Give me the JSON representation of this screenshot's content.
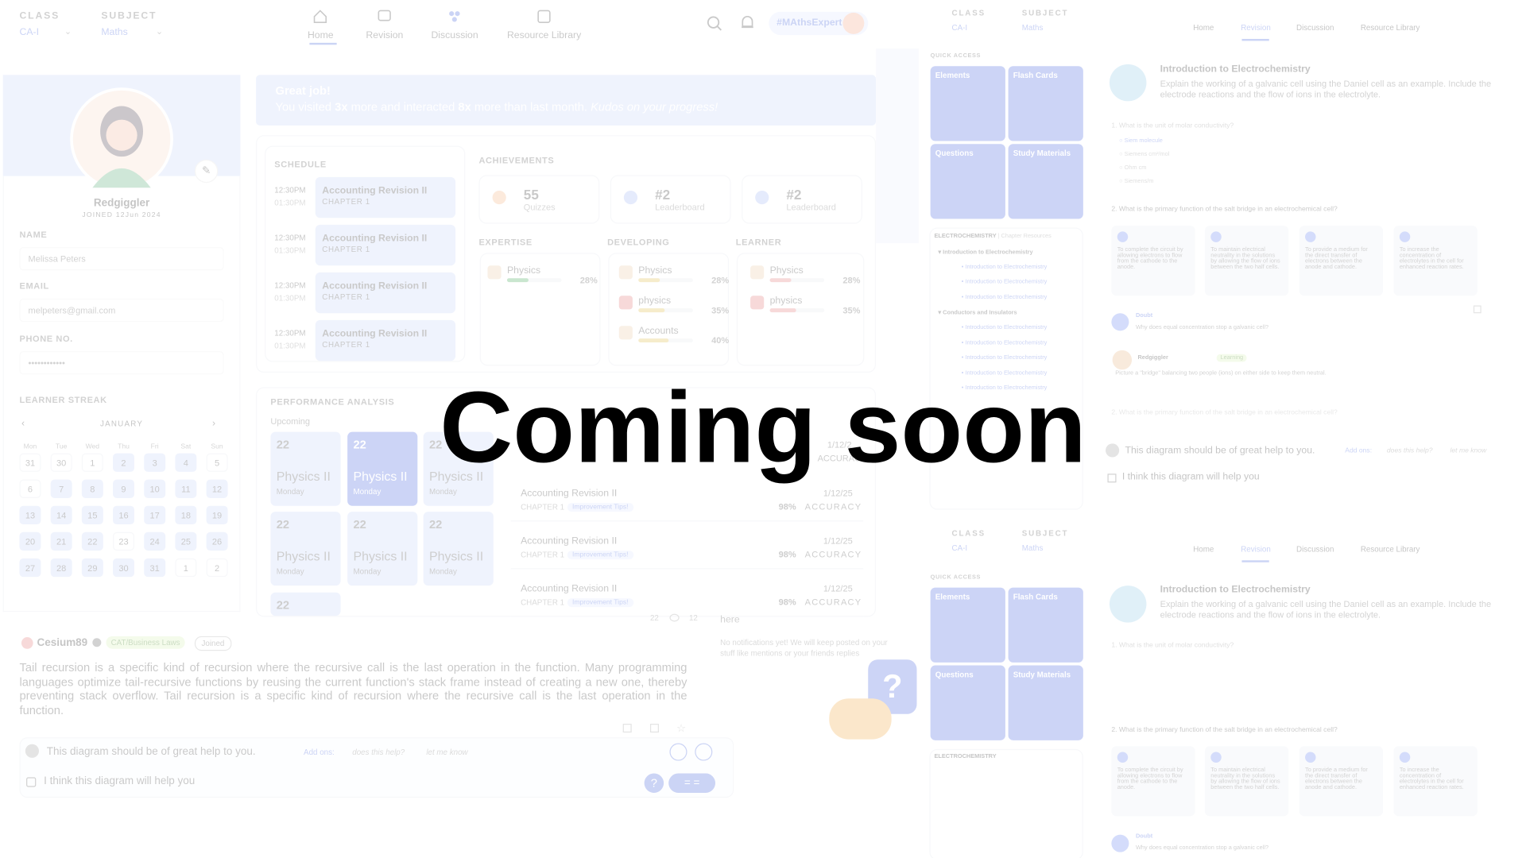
{
  "header": {
    "class_label": "CLASS",
    "class_value": "CA-I",
    "subject_label": "SUBJECT",
    "subject_value": "Maths",
    "tabs": [
      "Home",
      "Revision",
      "Discussion",
      "Resource Library"
    ],
    "hashtag": "#MAthsExpert"
  },
  "banner": {
    "title": "Great job!",
    "text_1": "You visited",
    "visits": "3x",
    "text_2": "more and interacted",
    "interact": "8x",
    "text_3": "more than last month.",
    "kudos": "Kudos on your progress!"
  },
  "profile": {
    "username": "Redgiggler",
    "joined": "JOINED 12Jun 2024",
    "name_label": "NAME",
    "name_value": "Melissa Peters",
    "email_label": "EMAIL",
    "email_value": "melpeters@gmail.com",
    "phone_label": "PHONE NO.",
    "phone_value": "••••••••••••"
  },
  "streak": {
    "title": "LEARNER STREAK",
    "month": "JANUARY",
    "weekdays": [
      "Mon",
      "Tue",
      "Wed",
      "Thu",
      "Fri",
      "Sat",
      "Sun"
    ],
    "days": [
      "31",
      "30",
      "1",
      "2",
      "3",
      "4",
      "5",
      "6",
      "7",
      "8",
      "9",
      "10",
      "11",
      "12",
      "13",
      "14",
      "15",
      "16",
      "17",
      "18",
      "19",
      "20",
      "21",
      "22",
      "23",
      "24",
      "25",
      "26",
      "27",
      "28",
      "29",
      "30",
      "31",
      "1",
      "2"
    ]
  },
  "schedule": {
    "title": "SCHEDULE",
    "items": [
      {
        "time": "12:30PM",
        "end": "01:30PM",
        "title": "Accounting Revision II",
        "chapter": "CHAPTER 1"
      },
      {
        "time": "12:30PM",
        "end": "01:30PM",
        "title": "Accounting Revision II",
        "chapter": "CHAPTER 1"
      },
      {
        "time": "12:30PM",
        "end": "01:30PM",
        "title": "Accounting Revision II",
        "chapter": "CHAPTER 1"
      },
      {
        "time": "12:30PM",
        "end": "01:30PM",
        "title": "Accounting Revision II",
        "chapter": "CHAPTER 1"
      }
    ]
  },
  "achievements": {
    "title": "ACHIEVEMENTS",
    "items": [
      {
        "value": "55",
        "label": "Quizzes"
      },
      {
        "value": "#2",
        "label": "Leaderboard"
      },
      {
        "value": "#2",
        "label": "Leaderboard"
      }
    ]
  },
  "expertise": {
    "title": "EXPERTISE",
    "items": [
      {
        "name": "Physics",
        "pct": "28%"
      }
    ]
  },
  "developing": {
    "title": "DEVELOPING",
    "items": [
      {
        "name": "Physics",
        "pct": "28%"
      },
      {
        "name": "physics",
        "pct": "35%"
      },
      {
        "name": "Accounts",
        "pct": "40%"
      }
    ]
  },
  "learner": {
    "title": "LEARNER",
    "items": [
      {
        "name": "Physics",
        "pct": "28%"
      },
      {
        "name": "physics",
        "pct": "35%"
      }
    ]
  },
  "performance": {
    "title": "PERFORMANCE ANALYSIS",
    "tab": "Upcoming",
    "cards": [
      {
        "day": "22",
        "subject": "Physics II",
        "weekday": "Monday"
      },
      {
        "day": "22",
        "subject": "Physics II",
        "weekday": "Monday"
      },
      {
        "day": "22",
        "subject": "Physics II",
        "weekday": "Monday"
      },
      {
        "day": "22",
        "subject": "Physics II",
        "weekday": "Monday"
      },
      {
        "day": "22",
        "subject": "Physics II",
        "weekday": "Monday"
      },
      {
        "day": "22",
        "subject": "Physics II",
        "weekday": "Monday"
      },
      {
        "day": "22",
        "subject": "",
        "weekday": ""
      }
    ],
    "rows": [
      {
        "title": "Accounting Revision II",
        "chapter": "CHAPTER 1",
        "tip": "Improvement Tips!",
        "date": "1/12/25",
        "accuracy": "98%",
        "acc_label": "ACCURACY"
      },
      {
        "title": "Accounting Revision II",
        "chapter": "CHAPTER 1",
        "tip": "Improvement Tips!",
        "date": "1/12/25",
        "accuracy": "98%",
        "acc_label": "ACCURACY"
      },
      {
        "title": "Accounting Revision II",
        "chapter": "CHAPTER 1",
        "tip": "Improvement Tips!",
        "date": "1/12/25",
        "accuracy": "98%",
        "acc_label": "ACCURACY"
      }
    ],
    "partial_word": "ACCURAC",
    "partial_date": "1/12/2"
  },
  "post": {
    "author": "Cesium89",
    "tag": "CAT/Business Laws",
    "joined": "Joined",
    "body": "Tail recursion is a specific kind of recursion where the recursive call is the last operation in the function. Many programming languages optimize tail-recursive functions by reusing the current function's stack frame instead of creating a new one, thereby preventing stack overflow. Tail recursion is a specific kind of recursion where the recursive call is the last operation in the function.",
    "stats": [
      "22",
      "12"
    ],
    "comment": "This diagram should be of great help to you.",
    "add_ons": "Add ons:",
    "chip1": "does this help?",
    "chip2": "let me know",
    "reply": "I think this diagram will help you"
  },
  "notifications": {
    "title": "here",
    "text": "No notifications yet! We will keep posted on your stuff like mentions or your friends replies"
  },
  "right_panel": {
    "quick_access": "QUICK ACCESS",
    "tiles": [
      "Elements",
      "Flash Cards",
      "Questions",
      "Study Materials"
    ],
    "chapter_label": "ELECTROCHEMISTRY",
    "chapter_sub": "| Chapter Resources",
    "tree_items": [
      "Introduction to Electrochemistry",
      "Introduction to Electrochemistry",
      "Introduction to Electrochemistry",
      "Introduction to Electrochemistry",
      "Conductors and Insulators",
      "Introduction to Electrochemistry",
      "Introduction to Electrochemistry",
      "Introduction to Electrochemistry",
      "Introduction to Electrochemistry",
      "Introduction to Electrochemistry"
    ],
    "q_title": "Introduction to Electrochemistry",
    "q_desc": "Explain the working of a galvanic cell using the Daniel cell as an example. Include the electrode reactions and the flow of ions in the electrolyte.",
    "q1": "1. What is the unit of molar conductivity?",
    "q1_opts": [
      "Siem molecule",
      "Siemens cm²/mol",
      "Ohm cm",
      "Siemens/m"
    ],
    "q2": "2. What is the primary function of the salt bridge in an electrochemical cell?",
    "answers": [
      "To complete the circuit by allowing electrons to flow from the cathode to the anode.",
      "To maintain electrical neutrality in the solutions by allowing the flow of ions between the two half cells.",
      "To provide a medium for the direct transfer of electrons between the anode and cathode.",
      "To increase the concentration of electrolytes in the cell for enhanced reaction rates."
    ],
    "c1_name": "Doubt",
    "c1_text": "Why does equal concentration stop a galvanic cell?",
    "c2_name": "Redgiggler",
    "c2_badge": "Learning",
    "c2_text": "Picture a \"bridge\" balancing two people (ions) on either side to keep them neutral.",
    "q3": "2. What is the primary function of the salt bridge in an electrochemical cell?",
    "comment": "This diagram should be of great help to you.",
    "add_ons": "Add ons:",
    "chip1": "does this help?",
    "chip2": "let me know",
    "reply": "I think this diagram will help you"
  },
  "overlay": {
    "message": "Coming soon"
  },
  "colors": {
    "accent": "#3b5bdb",
    "soft_blue": "#c5d2fb",
    "overlay_text": "#000000"
  }
}
